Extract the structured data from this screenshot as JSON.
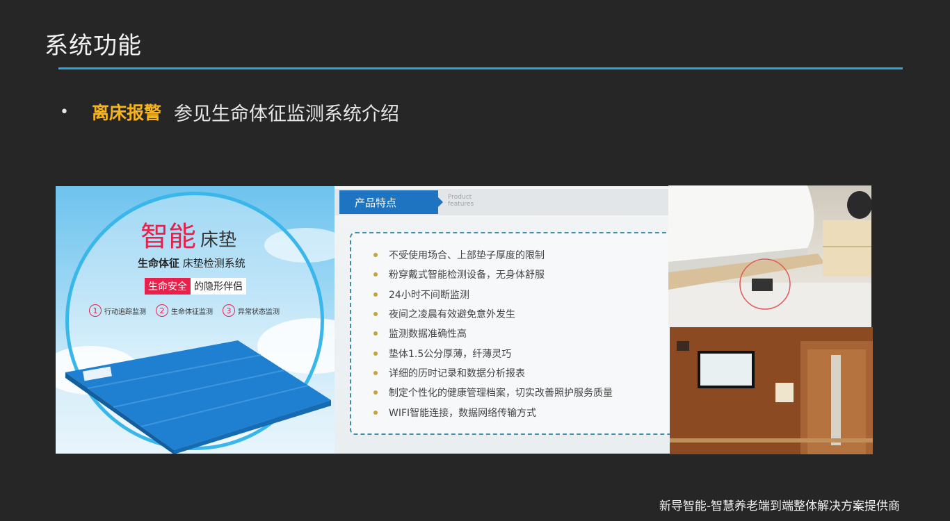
{
  "slide": {
    "title": "系统功能",
    "bullet_key": "离床报警",
    "bullet_text": "参见生命体征监测系统介绍",
    "footer": "新导智能-智慧养老端到端整体解决方案提供商"
  },
  "mat_image": {
    "title_main": "智能",
    "title_sub": "床垫",
    "subtitle_bold": "生命体征",
    "subtitle_rest": " 床垫检测系统",
    "tag_red": "生命安全",
    "tag_white": "的隐形伴侣",
    "features": [
      {
        "num": "1",
        "label": "行动追踪监测"
      },
      {
        "num": "2",
        "label": "生命体征监测"
      },
      {
        "num": "3",
        "label": "异常状态监测"
      }
    ]
  },
  "features_image": {
    "header": "产品特点",
    "header_en_1": "Product",
    "header_en_2": "features",
    "items": [
      "不受使用场合、上部垫子厚度的限制",
      "粉穿戴式智能检测设备，无身体舒服",
      "24小时不间断监测",
      "夜间之凌晨有效避免意外发生",
      "监测数据准确性高",
      "垫体1.5公分厚薄，纤薄灵巧",
      "详细的历时记录和数据分析报表",
      "制定个性化的健康管理档案，切实改善照护服务质量",
      "WIFI智能连接，数据网络传输方式"
    ]
  },
  "colors": {
    "background": "#262626",
    "accent_rule": "#29a8e0",
    "bullet_key": "#f5b41e",
    "header_blue": "#1f74c2"
  }
}
